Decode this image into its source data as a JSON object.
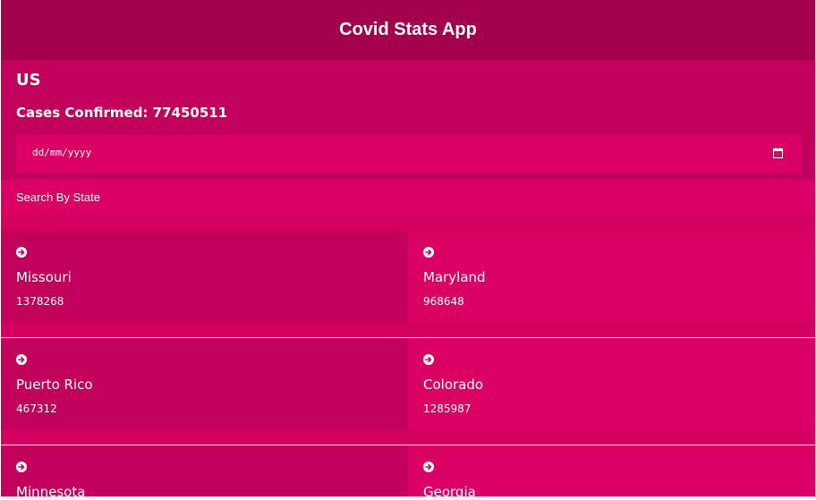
{
  "header": {
    "title": "Covid Stats App"
  },
  "summary": {
    "country": "US",
    "cases_confirmed": "Cases Confirmed: 77450511"
  },
  "date_input": {
    "placeholder": "dd/mm/yyyy",
    "icon": "calendar-icon"
  },
  "search": {
    "label": "Search By State"
  },
  "colors": {
    "header_bg": "#a3004d",
    "panel_bg": "#c2005b",
    "accent_bg": "#db0063"
  },
  "states": [
    {
      "name": "Missouri",
      "cases": "1378268",
      "icon": "arrow-circle-right-icon"
    },
    {
      "name": "Maryland",
      "cases": "968648",
      "icon": "arrow-circle-right-icon"
    },
    {
      "name": "Puerto Rico",
      "cases": "467312",
      "icon": "arrow-circle-right-icon"
    },
    {
      "name": "Colorado",
      "cases": "1285987",
      "icon": "arrow-circle-right-icon"
    },
    {
      "name": "Minnesota",
      "cases": "",
      "icon": "arrow-circle-right-icon"
    },
    {
      "name": "Georgia",
      "cases": "",
      "icon": "arrow-circle-right-icon"
    }
  ]
}
